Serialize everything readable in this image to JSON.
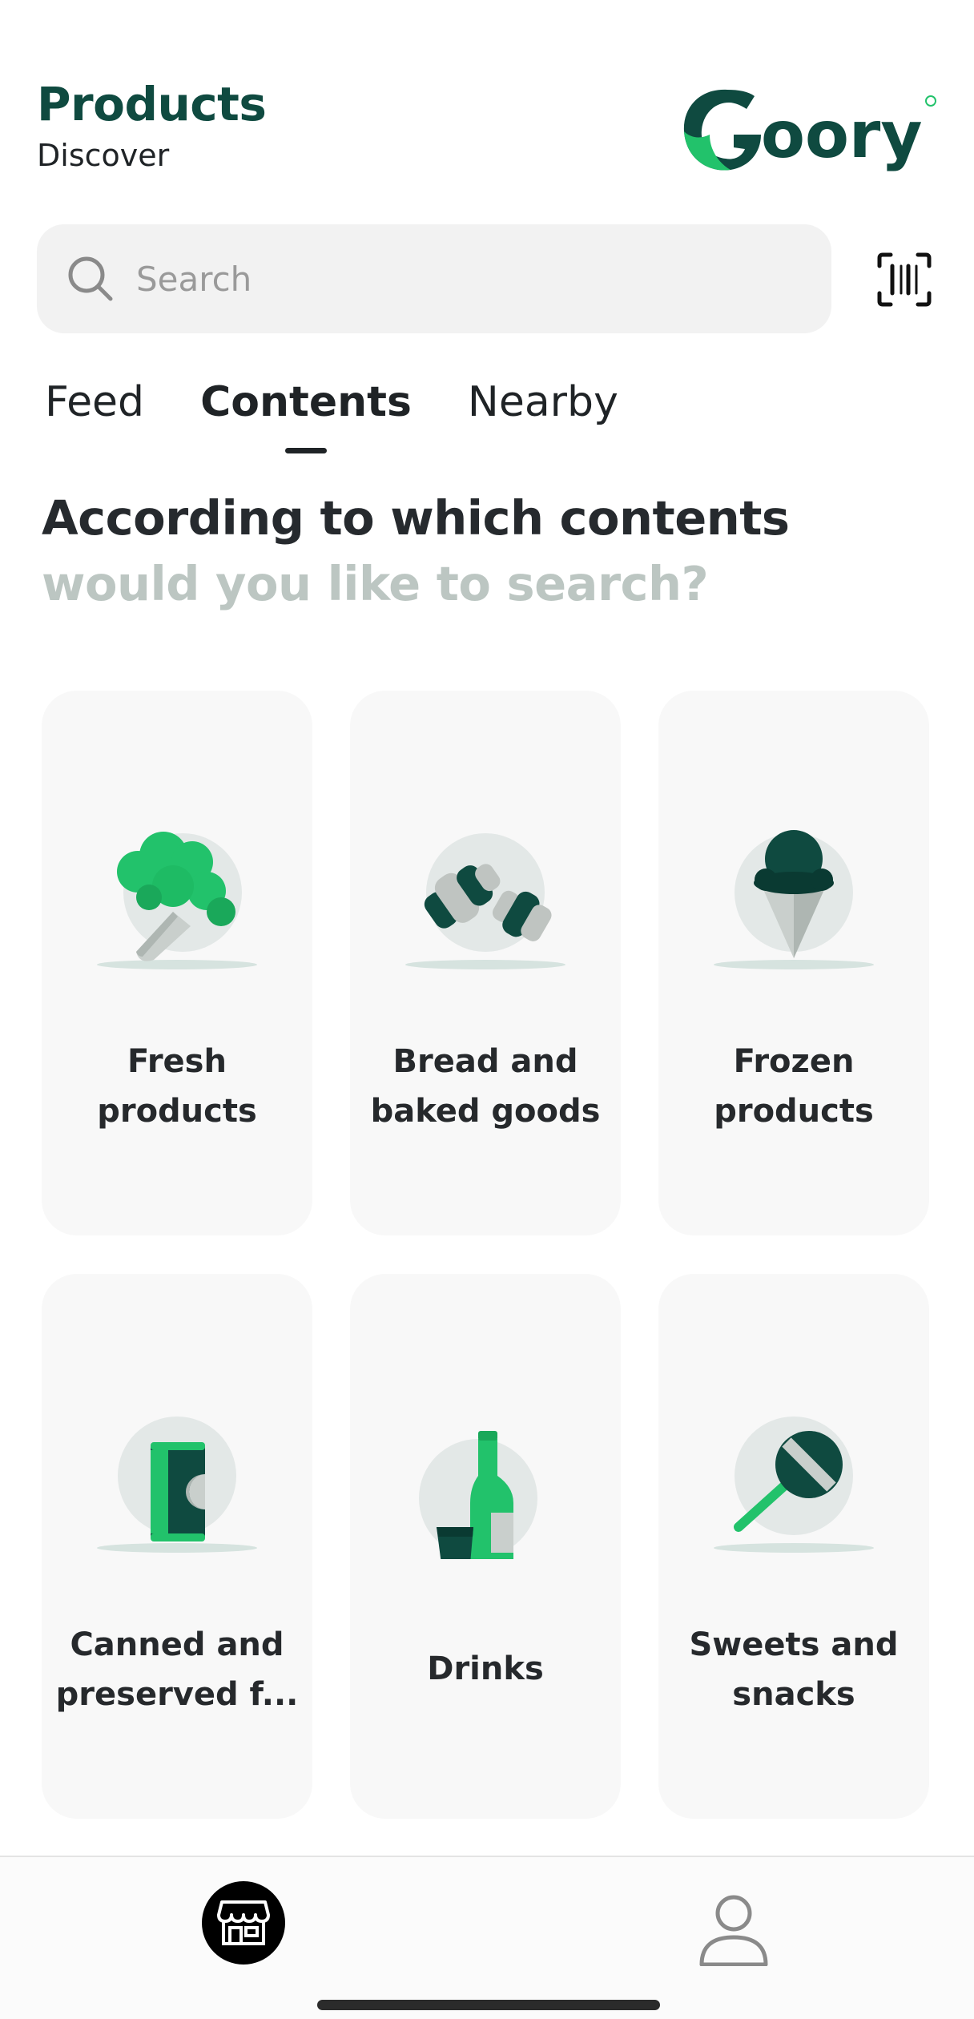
{
  "header": {
    "title": "Products",
    "subtitle": "Discover",
    "logo_text": "Goory",
    "brand_color": "#0f4a40",
    "accent_color": "#22c26b"
  },
  "search": {
    "placeholder": "Search",
    "scan_icon": "barcode-scan-icon"
  },
  "tabs": [
    {
      "label": "Feed",
      "active": false
    },
    {
      "label": "Contents",
      "active": true
    },
    {
      "label": "Nearby",
      "active": false
    }
  ],
  "heading": {
    "line1": "According to which contents",
    "line2": "would you like to search?"
  },
  "categories": [
    {
      "label": "Fresh\nproducts",
      "icon": "broccoli-icon"
    },
    {
      "label": "Bread and\nbaked goods",
      "icon": "croissant-icon"
    },
    {
      "label": "Frozen\nproducts",
      "icon": "ice-cream-icon"
    },
    {
      "label": "Canned and\npreserved f...",
      "icon": "can-icon"
    },
    {
      "label": "Drinks",
      "icon": "bottle-icon"
    },
    {
      "label": "Sweets and\nsnacks",
      "icon": "lollipop-icon"
    }
  ],
  "bottom_nav": {
    "items": [
      {
        "icon": "store-icon",
        "active": true
      },
      {
        "icon": "profile-icon",
        "active": false
      }
    ]
  }
}
